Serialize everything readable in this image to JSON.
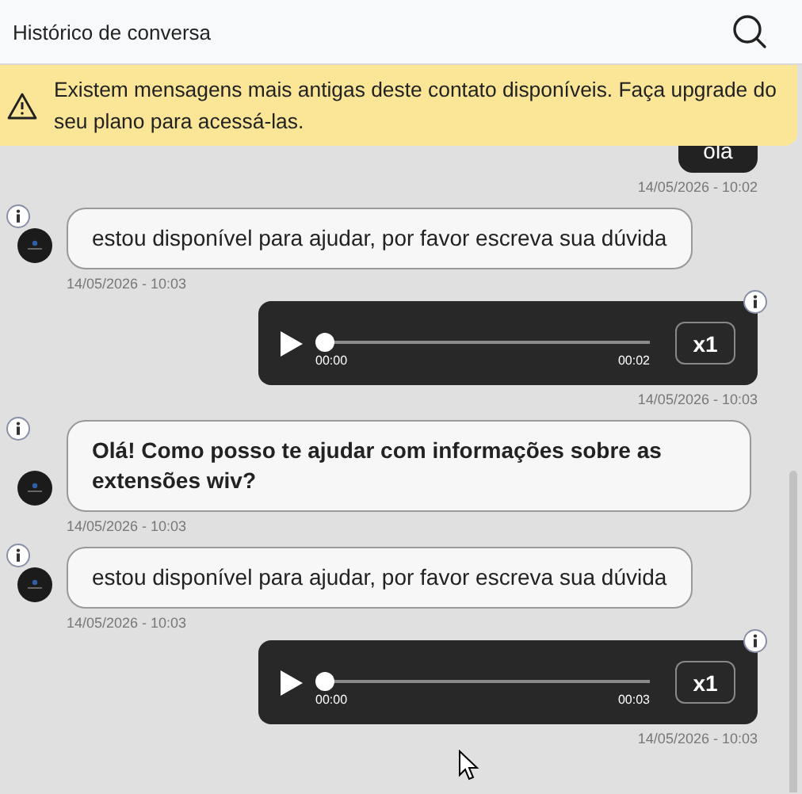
{
  "header": {
    "title": "Histórico de conversa"
  },
  "notice": {
    "text": "Existem mensagens mais antigas deste contato disponíveis. Faça upgrade do seu plano para acessá-las."
  },
  "messages": [
    {
      "kind": "text",
      "outgoing": true,
      "text": "ola",
      "bold": false,
      "time": "14/05/2026 - 10:02"
    },
    {
      "kind": "text",
      "outgoing": false,
      "text": "estou disponível para ajudar, por favor escreva sua dúvida",
      "bold": false,
      "time": "14/05/2026 - 10:03"
    },
    {
      "kind": "audio",
      "outgoing": true,
      "playing": false,
      "level": 0,
      "current": "00:00",
      "duration": "00:02",
      "speed": "x1",
      "time": "14/05/2026 - 10:03"
    },
    {
      "kind": "text",
      "outgoing": false,
      "text": "Olá! Como posso te ajudar com informações sobre as extensões wiv?",
      "bold": true,
      "time": "14/05/2026 - 10:03"
    },
    {
      "kind": "text",
      "outgoing": false,
      "text": "estou disponível para ajudar, por favor escreva sua dúvida",
      "bold": false,
      "time": "14/05/2026 - 10:03"
    },
    {
      "kind": "audio",
      "outgoing": true,
      "playing": false,
      "level": 0,
      "current": "00:00",
      "duration": "00:03",
      "speed": "x1",
      "time": "14/05/2026 - 10:03"
    }
  ]
}
